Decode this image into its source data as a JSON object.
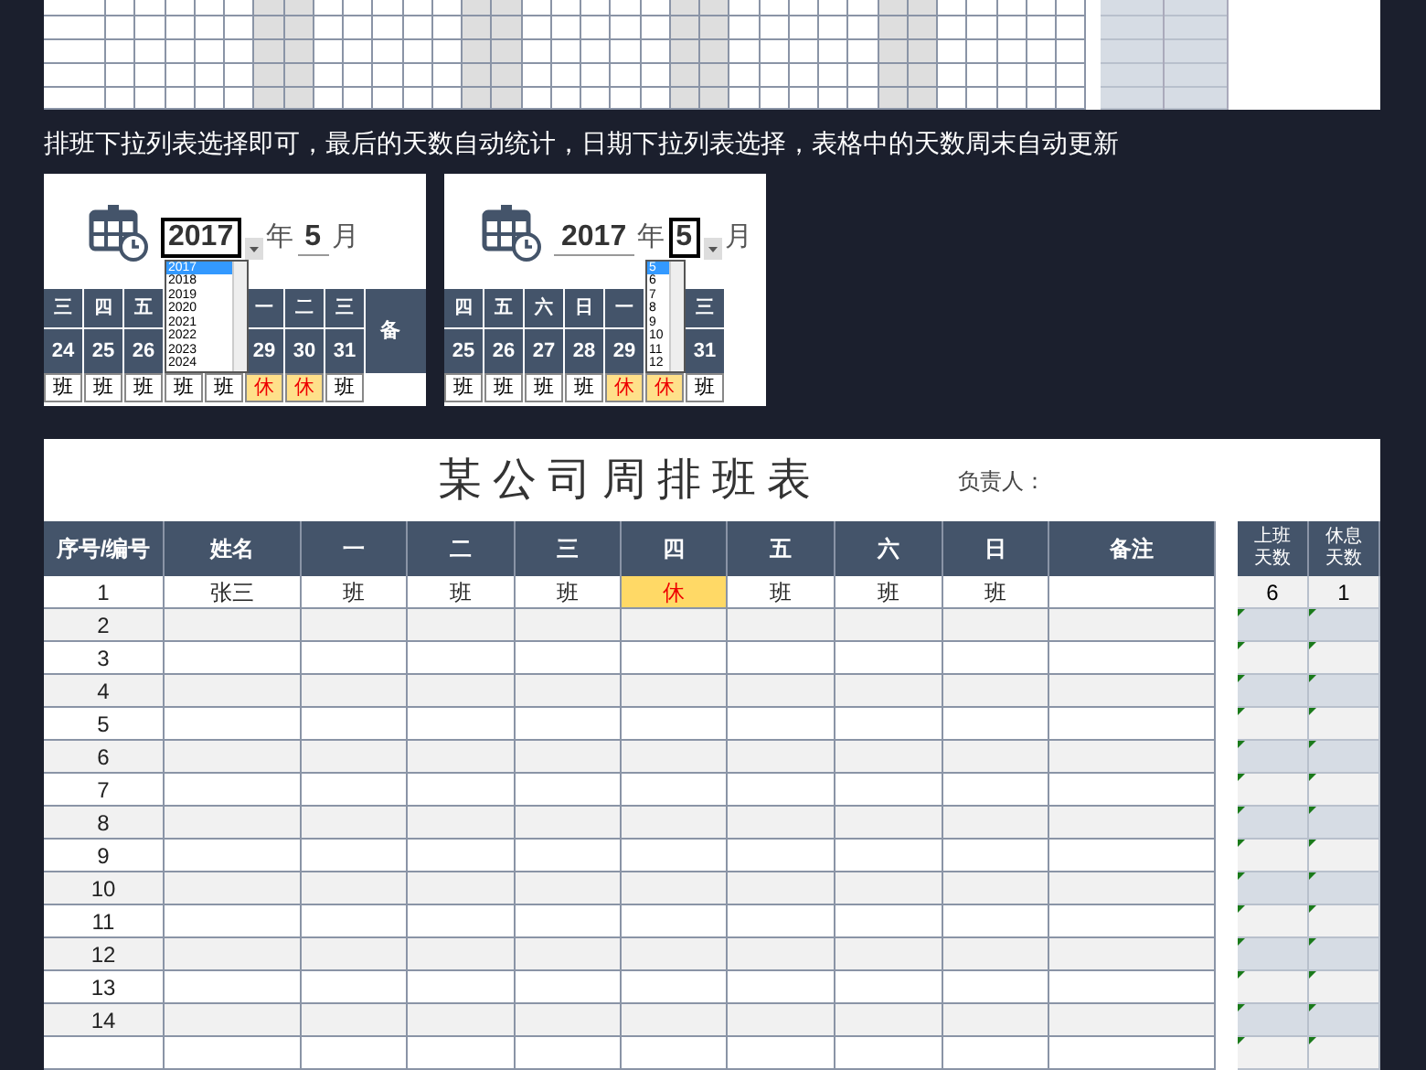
{
  "top_sheet": {
    "columns": [
      {
        "weekend": false
      },
      {
        "weekend": false
      },
      {
        "weekend": false
      },
      {
        "weekend": false
      },
      {
        "weekend": false
      },
      {
        "weekend": true
      },
      {
        "weekend": true
      },
      {
        "weekend": false
      },
      {
        "weekend": false
      },
      {
        "weekend": false
      },
      {
        "weekend": false
      },
      {
        "weekend": false
      },
      {
        "weekend": true
      },
      {
        "weekend": true
      },
      {
        "weekend": false
      },
      {
        "weekend": false
      },
      {
        "weekend": false
      },
      {
        "weekend": false
      },
      {
        "weekend": false
      },
      {
        "weekend": true
      },
      {
        "weekend": true
      },
      {
        "weekend": false
      },
      {
        "weekend": false
      },
      {
        "weekend": false
      },
      {
        "weekend": false
      },
      {
        "weekend": false
      },
      {
        "weekend": true
      },
      {
        "weekend": true
      },
      {
        "weekend": false
      },
      {
        "weekend": false
      },
      {
        "weekend": false
      },
      {
        "weekend": false
      },
      {
        "weekend": false
      }
    ]
  },
  "caption": "排班下拉列表选择即可，最后的天数自动统计，日期下拉列表选择，表格中的天数周末自动更新",
  "insets": [
    {
      "year": "2017",
      "year_unit": "年",
      "month": "5",
      "month_unit": "月",
      "year_open": true,
      "month_open": false,
      "options": [
        {
          "label": "2017",
          "selected": true
        },
        {
          "label": "2018",
          "selected": false
        },
        {
          "label": "2019",
          "selected": false
        },
        {
          "label": "2020",
          "selected": false
        },
        {
          "label": "2021",
          "selected": false
        },
        {
          "label": "2022",
          "selected": false
        },
        {
          "label": "2023",
          "selected": false
        },
        {
          "label": "2024",
          "selected": false
        }
      ],
      "columns": [
        {
          "weekday": "三",
          "date": "24",
          "shift": "班",
          "rest": false
        },
        {
          "weekday": "四",
          "date": "25",
          "shift": "班",
          "rest": false
        },
        {
          "weekday": "五",
          "date": "26",
          "shift": "班",
          "rest": false
        },
        {
          "shift": "班",
          "rest": false
        },
        {
          "shift": "班",
          "rest": false
        },
        {
          "weekday": "一",
          "date": "29",
          "shift": "休",
          "rest": true
        },
        {
          "weekday": "二",
          "date": "30",
          "shift": "休",
          "rest": true
        },
        {
          "weekday": "三",
          "date": "31",
          "shift": "班",
          "rest": false
        }
      ],
      "note_header": "备"
    },
    {
      "year": "2017",
      "year_unit": "年",
      "month": "5",
      "month_unit": "月",
      "year_open": false,
      "month_open": true,
      "options": [
        {
          "label": "5",
          "selected": true
        },
        {
          "label": "6",
          "selected": false
        },
        {
          "label": "7",
          "selected": false
        },
        {
          "label": "8",
          "selected": false
        },
        {
          "label": "9",
          "selected": false
        },
        {
          "label": "10",
          "selected": false
        },
        {
          "label": "11",
          "selected": false
        },
        {
          "label": "12",
          "selected": false
        }
      ],
      "columns": [
        {
          "weekday": "四",
          "date": "25",
          "shift": "班",
          "rest": false
        },
        {
          "weekday": "五",
          "date": "26",
          "shift": "班",
          "rest": false
        },
        {
          "weekday": "六",
          "date": "27",
          "shift": "班",
          "rest": false
        },
        {
          "weekday": "日",
          "date": "28",
          "shift": "班",
          "rest": false
        },
        {
          "weekday": "一",
          "date": "29",
          "shift": "休",
          "rest": true
        },
        {
          "shift": "休",
          "rest": true
        },
        {
          "weekday": "三",
          "date": "31",
          "shift": "班",
          "rest": false
        }
      ]
    }
  ],
  "schedule": {
    "title": "某公司周排班表",
    "manager_label": "负责人：",
    "columns": [
      "序号/编号",
      "姓名",
      "一",
      "二",
      "三",
      "四",
      "五",
      "六",
      "日",
      "备注"
    ],
    "summary_columns": [
      "上班天数",
      "休息天数"
    ],
    "rows": [
      {
        "no": "1",
        "name": "张三",
        "shifts": [
          {
            "text": "班",
            "rest": false
          },
          {
            "text": "班",
            "rest": false
          },
          {
            "text": "班",
            "rest": false
          },
          {
            "text": "休",
            "rest": true
          },
          {
            "text": "班",
            "rest": false
          },
          {
            "text": "班",
            "rest": false
          },
          {
            "text": "班",
            "rest": false
          }
        ],
        "work_days": "6",
        "rest_days": "1"
      },
      {
        "no": "2"
      },
      {
        "no": "3"
      },
      {
        "no": "4"
      },
      {
        "no": "5"
      },
      {
        "no": "6"
      },
      {
        "no": "7"
      },
      {
        "no": "8"
      },
      {
        "no": "9"
      },
      {
        "no": "10"
      },
      {
        "no": "11"
      },
      {
        "no": "12"
      },
      {
        "no": "13"
      },
      {
        "no": "14"
      }
    ]
  }
}
